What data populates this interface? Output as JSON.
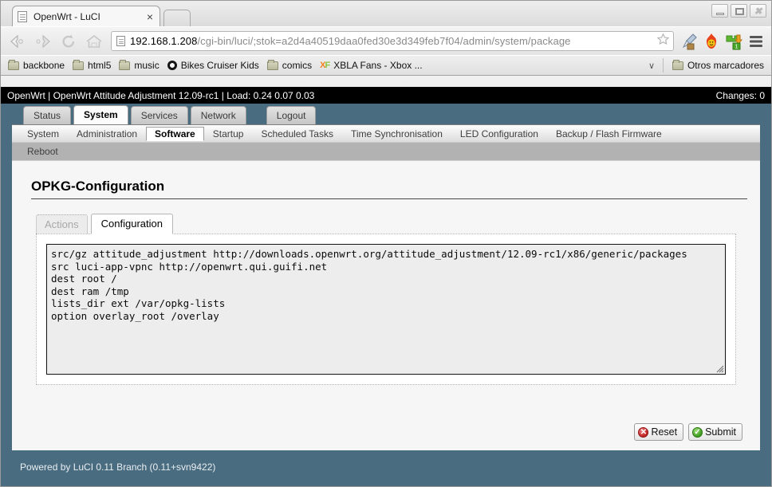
{
  "browser": {
    "tab": {
      "title": "OpenWrt - LuCI",
      "favicon": "page-icon",
      "close": "×"
    },
    "new_tab_label": "",
    "window_controls": {
      "minimize": "minimize-icon",
      "maximize": "maximize-icon",
      "close": "✖"
    },
    "nav": {
      "back": "back-icon",
      "forward": "forward-icon",
      "reload": "reload-icon",
      "home": "home-icon"
    },
    "url": {
      "host": "192.168.1.208",
      "path": "/cgi-bin/luci/;stok=a2d4a40519daa0fed30e3d349feb7f04/admin/system/package",
      "placeholder": "Search or enter address"
    },
    "toolbar_icons": [
      "eyedropper-icon",
      "flame-icon",
      "extension-download-icon",
      "menu-icon"
    ],
    "bookmarks": [
      {
        "label": "backbone",
        "icon": "folder-icon"
      },
      {
        "label": "html5",
        "icon": "folder-icon"
      },
      {
        "label": "music",
        "icon": "folder-icon"
      },
      {
        "label": "Bikes Cruiser Kids",
        "icon": "ring-icon"
      },
      {
        "label": "comics",
        "icon": "folder-icon"
      },
      {
        "label": "XBLA Fans - Xbox ...",
        "icon": "xf-icon"
      }
    ],
    "bookmarks_overflow": "∨",
    "other_bookmarks": {
      "label": "Otros marcadores",
      "icon": "folder-icon"
    }
  },
  "luci": {
    "header": {
      "left": "OpenWrt | OpenWrt Attitude Adjustment 12.09-rc1 | Load: 0.24 0.07 0.03",
      "right": "Changes: 0"
    },
    "main_tabs": [
      {
        "label": "Status",
        "active": false
      },
      {
        "label": "System",
        "active": true
      },
      {
        "label": "Services",
        "active": false
      },
      {
        "label": "Network",
        "active": false
      },
      {
        "label": "Logout",
        "active": false,
        "spaced": true
      }
    ],
    "sub_nav_row1": [
      {
        "label": "System",
        "active": false
      },
      {
        "label": "Administration",
        "active": false
      },
      {
        "label": "Software",
        "active": true
      },
      {
        "label": "Startup",
        "active": false
      },
      {
        "label": "Scheduled Tasks",
        "active": false
      },
      {
        "label": "Time Synchronisation",
        "active": false
      },
      {
        "label": "LED Configuration",
        "active": false
      },
      {
        "label": "Backup / Flash Firmware",
        "active": false
      }
    ],
    "sub_nav_row2": [
      {
        "label": "Reboot",
        "active": false
      }
    ],
    "page_title": "OPKG-Configuration",
    "cbi_tabs": [
      {
        "label": "Actions",
        "active": false
      },
      {
        "label": "Configuration",
        "active": true
      }
    ],
    "textarea": {
      "value": "src/gz attitude_adjustment http://downloads.openwrt.org/attitude_adjustment/12.09-rc1/x86/generic/packages\nsrc luci-app-vpnc http://openwrt.qui.guifi.net\ndest root /\ndest ram /tmp\nlists_dir ext /var/opkg-lists\noption overlay_root /overlay\n"
    },
    "buttons": {
      "reset": {
        "label": "Reset",
        "icon": "reset-icon",
        "glyph": "✕",
        "color": "#c02222"
      },
      "submit": {
        "label": "Submit",
        "icon": "submit-icon",
        "glyph": "✓",
        "color": "#3e9c1e"
      }
    },
    "footer": "Powered by LuCI 0.11 Branch (0.11+svn9422)"
  },
  "colors": {
    "luci_background": "#4a6c80",
    "header_bar": "#000000",
    "content_background": "#f6f6f6"
  }
}
